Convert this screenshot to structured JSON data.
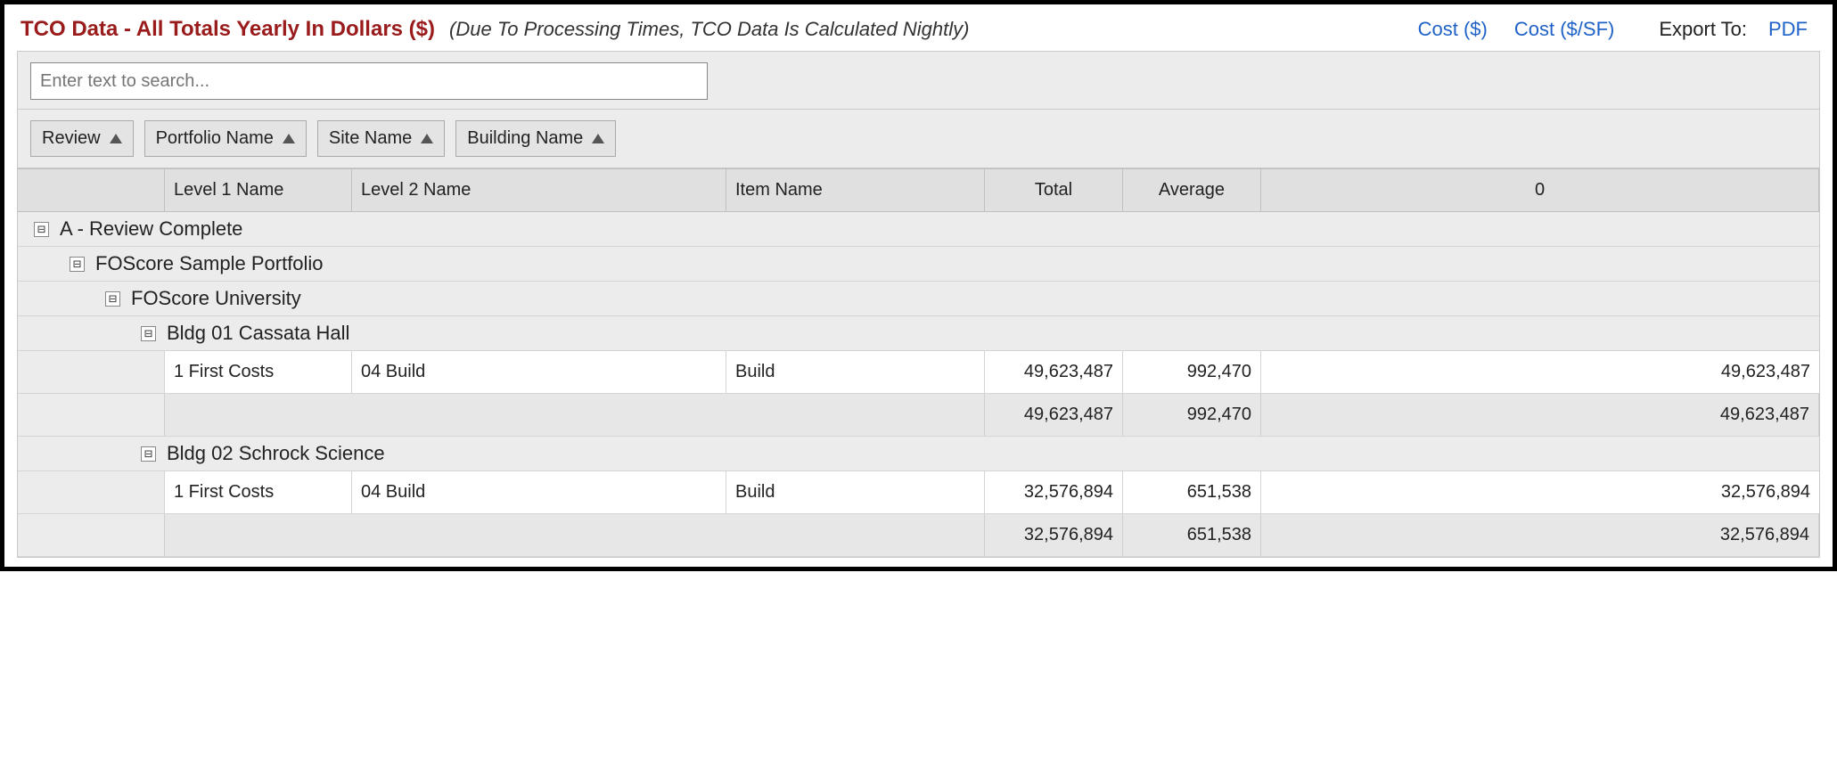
{
  "header": {
    "title": "TCO Data - All Totals Yearly In Dollars ($)",
    "subtitle": "(Due To Processing Times, TCO Data Is Calculated Nightly)",
    "cost_link": "Cost ($)",
    "cost_sf_link": "Cost ($/SF)",
    "export_label": "Export To:",
    "pdf_link": "PDF"
  },
  "search": {
    "placeholder": "Enter text to search..."
  },
  "group_chips": [
    {
      "label": "Review"
    },
    {
      "label": "Portfolio Name"
    },
    {
      "label": "Site Name"
    },
    {
      "label": "Building Name"
    }
  ],
  "columns": {
    "level1": "Level 1 Name",
    "level2": "Level 2 Name",
    "item": "Item Name",
    "total": "Total",
    "average": "Average",
    "year0": "0"
  },
  "groups": {
    "review": "A - Review Complete",
    "portfolio": "FOScore Sample Portfolio",
    "site": "FOScore University",
    "buildings": [
      {
        "name": "Bldg 01 Cassata Hall",
        "rows": [
          {
            "l1": "1 First Costs",
            "l2": "04 Build",
            "item": "Build",
            "total": "49,623,487",
            "avg": "992,470",
            "y0": "49,623,487"
          }
        ],
        "subtotal": {
          "total": "49,623,487",
          "avg": "992,470",
          "y0": "49,623,487"
        }
      },
      {
        "name": "Bldg 02 Schrock Science",
        "rows": [
          {
            "l1": "1 First Costs",
            "l2": "04 Build",
            "item": "Build",
            "total": "32,576,894",
            "avg": "651,538",
            "y0": "32,576,894"
          }
        ],
        "subtotal": {
          "total": "32,576,894",
          "avg": "651,538",
          "y0": "32,576,894"
        }
      }
    ]
  },
  "toggle_glyph": "⊟"
}
